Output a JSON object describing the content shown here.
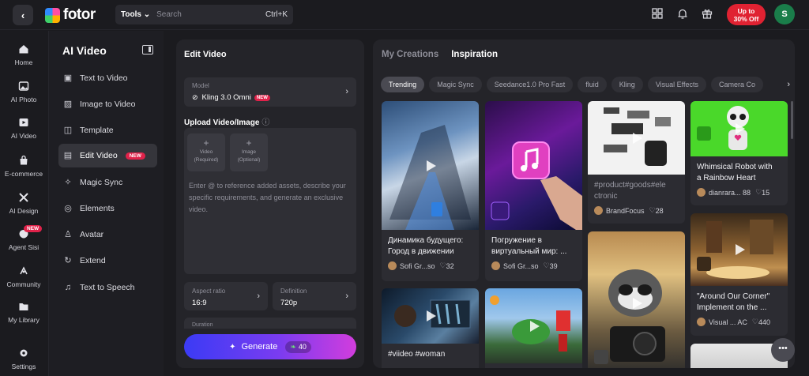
{
  "topbar": {
    "brand": "fotor",
    "search_tools": "Tools ⌄",
    "search_placeholder": "Search",
    "search_shortcut": "Ctrl+K",
    "promo_line1": "Up to",
    "promo_line2": "30% Off",
    "avatar_initial": "S"
  },
  "rail": {
    "items": [
      {
        "label": "Home",
        "icon": "home-icon"
      },
      {
        "label": "AI Photo",
        "icon": "ai-photo-icon"
      },
      {
        "label": "AI Video",
        "icon": "ai-video-icon"
      },
      {
        "label": "E-commerce",
        "icon": "shopping-bag-icon"
      },
      {
        "label": "AI Design",
        "icon": "ai-design-icon"
      },
      {
        "label": "Agent Sisi",
        "icon": "agent-icon"
      },
      {
        "label": "Community",
        "icon": "community-icon"
      },
      {
        "label": "My Library",
        "icon": "folder-icon"
      },
      {
        "label": "Settings",
        "icon": "gear-icon"
      }
    ],
    "agent_badge": "NEW"
  },
  "sidemenu": {
    "title": "AI Video",
    "items": [
      {
        "label": "Text to Video",
        "icon": "text-to-video-icon"
      },
      {
        "label": "Image to Video",
        "icon": "image-to-video-icon"
      },
      {
        "label": "Template",
        "icon": "template-icon"
      },
      {
        "label": "Edit Video",
        "icon": "edit-video-icon",
        "badge": "NEW",
        "active": true
      },
      {
        "label": "Magic Sync",
        "icon": "magic-sync-icon"
      },
      {
        "label": "Elements",
        "icon": "elements-icon"
      },
      {
        "label": "Avatar",
        "icon": "avatar-icon"
      },
      {
        "label": "Extend",
        "icon": "extend-icon"
      },
      {
        "label": "Text to Speech",
        "icon": "text-to-speech-icon"
      }
    ]
  },
  "edit": {
    "title": "Edit Video",
    "model_label": "Model",
    "model_value": "Kling 3.0 Omni",
    "model_badge": "NEW",
    "upload_label": "Upload Video/Image",
    "slot_video_line1": "Video",
    "slot_video_line2": "(Required)",
    "slot_image_line1": "Image",
    "slot_image_line2": "(Optional)",
    "prompt_placeholder": "Enter @ to reference added assets, describe your specific requirements, and generate an exclusive video.",
    "aspect_label": "Aspect ratio",
    "aspect_value": "16:9",
    "definition_label": "Definition",
    "definition_value": "720p",
    "duration_label": "Duration",
    "generate_label": "Generate",
    "generate_credits": "40"
  },
  "gallery": {
    "tabs": [
      "My Creations",
      "Inspiration"
    ],
    "active_tab": "Inspiration",
    "chips": [
      "Trending",
      "Magic Sync",
      "Seedance1.0 Pro Fast",
      "fluid",
      "Kling",
      "Visual Effects",
      "Camera Co"
    ],
    "cards": [
      {
        "title_line1": "Динамика будущего:",
        "title_line2": "Город в движении",
        "author": "Sofi Gr...so",
        "likes": "32"
      },
      {
        "title_line1": "Погружение в",
        "title_line2": "виртуальный мир: ...",
        "author": "Sofi Gr...so",
        "likes": "39"
      },
      {
        "title_line1": "#product#goods#ele",
        "title_line2": "ctronic",
        "author": "BrandFocus",
        "likes": "28"
      },
      {
        "title_line1": "Whimsical Robot with",
        "title_line2": "a Rainbow Heart",
        "author": "dianrara...",
        "author_count": "88",
        "likes": "15"
      },
      {
        "title_line1": "\"Around Our Corner\"",
        "title_line2": "Implement on the ...",
        "author": "Visual ... AC",
        "likes": "440"
      },
      {
        "title_line1": "#viideo #woman",
        "title_line2": "",
        "author": "",
        "likes": ""
      }
    ]
  },
  "colors": {
    "accent_red": "#e0224a",
    "generate_gradient_start": "#3b3bf5",
    "generate_gradient_end": "#d23ddd"
  }
}
